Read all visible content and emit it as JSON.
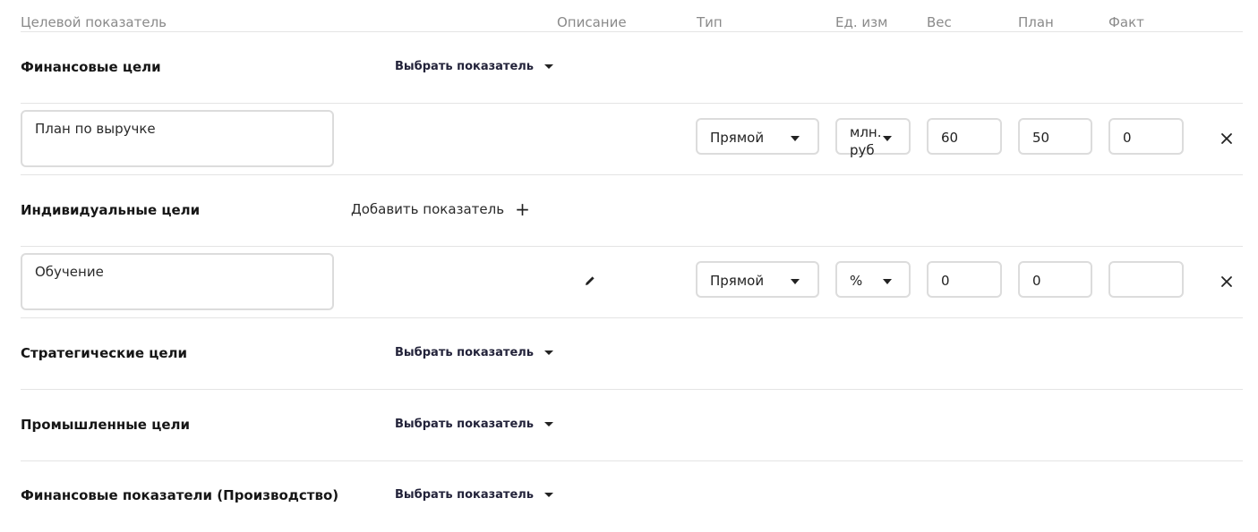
{
  "header": {
    "col_indicator": "Целевой показатель",
    "col_description": "Описание",
    "col_type": "Тип",
    "col_unit": "Ед. изм",
    "col_weight": "Вес",
    "col_plan": "План",
    "col_fact": "Факт"
  },
  "sections": {
    "financial": {
      "title": "Финансовые цели",
      "action": "Выбрать показатель"
    },
    "individual": {
      "title": "Индивидуальные цели",
      "action": "Добавить показатель"
    },
    "strategic": {
      "title": "Стратегические цели",
      "action": "Выбрать показатель"
    },
    "industrial": {
      "title": "Промышленные цели",
      "action": "Выбрать показатель"
    },
    "financial_production": {
      "title": "Финансовые показатели (Производство)",
      "action": "Выбрать показатель"
    }
  },
  "rows": {
    "revenue": {
      "name": "План по выручке",
      "type": "Прямой",
      "unit_line1": "млн.",
      "unit_line2": "руб",
      "weight": "60",
      "plan": "50",
      "fact": "0"
    },
    "training": {
      "name": "Обучение",
      "type": "Прямой",
      "unit": "%",
      "weight": "0",
      "plan": "0",
      "fact": ""
    }
  },
  "icons": {
    "caret": "caret-down-icon",
    "plus": "plus-icon",
    "edit": "pencil-icon",
    "close": "close-icon"
  }
}
